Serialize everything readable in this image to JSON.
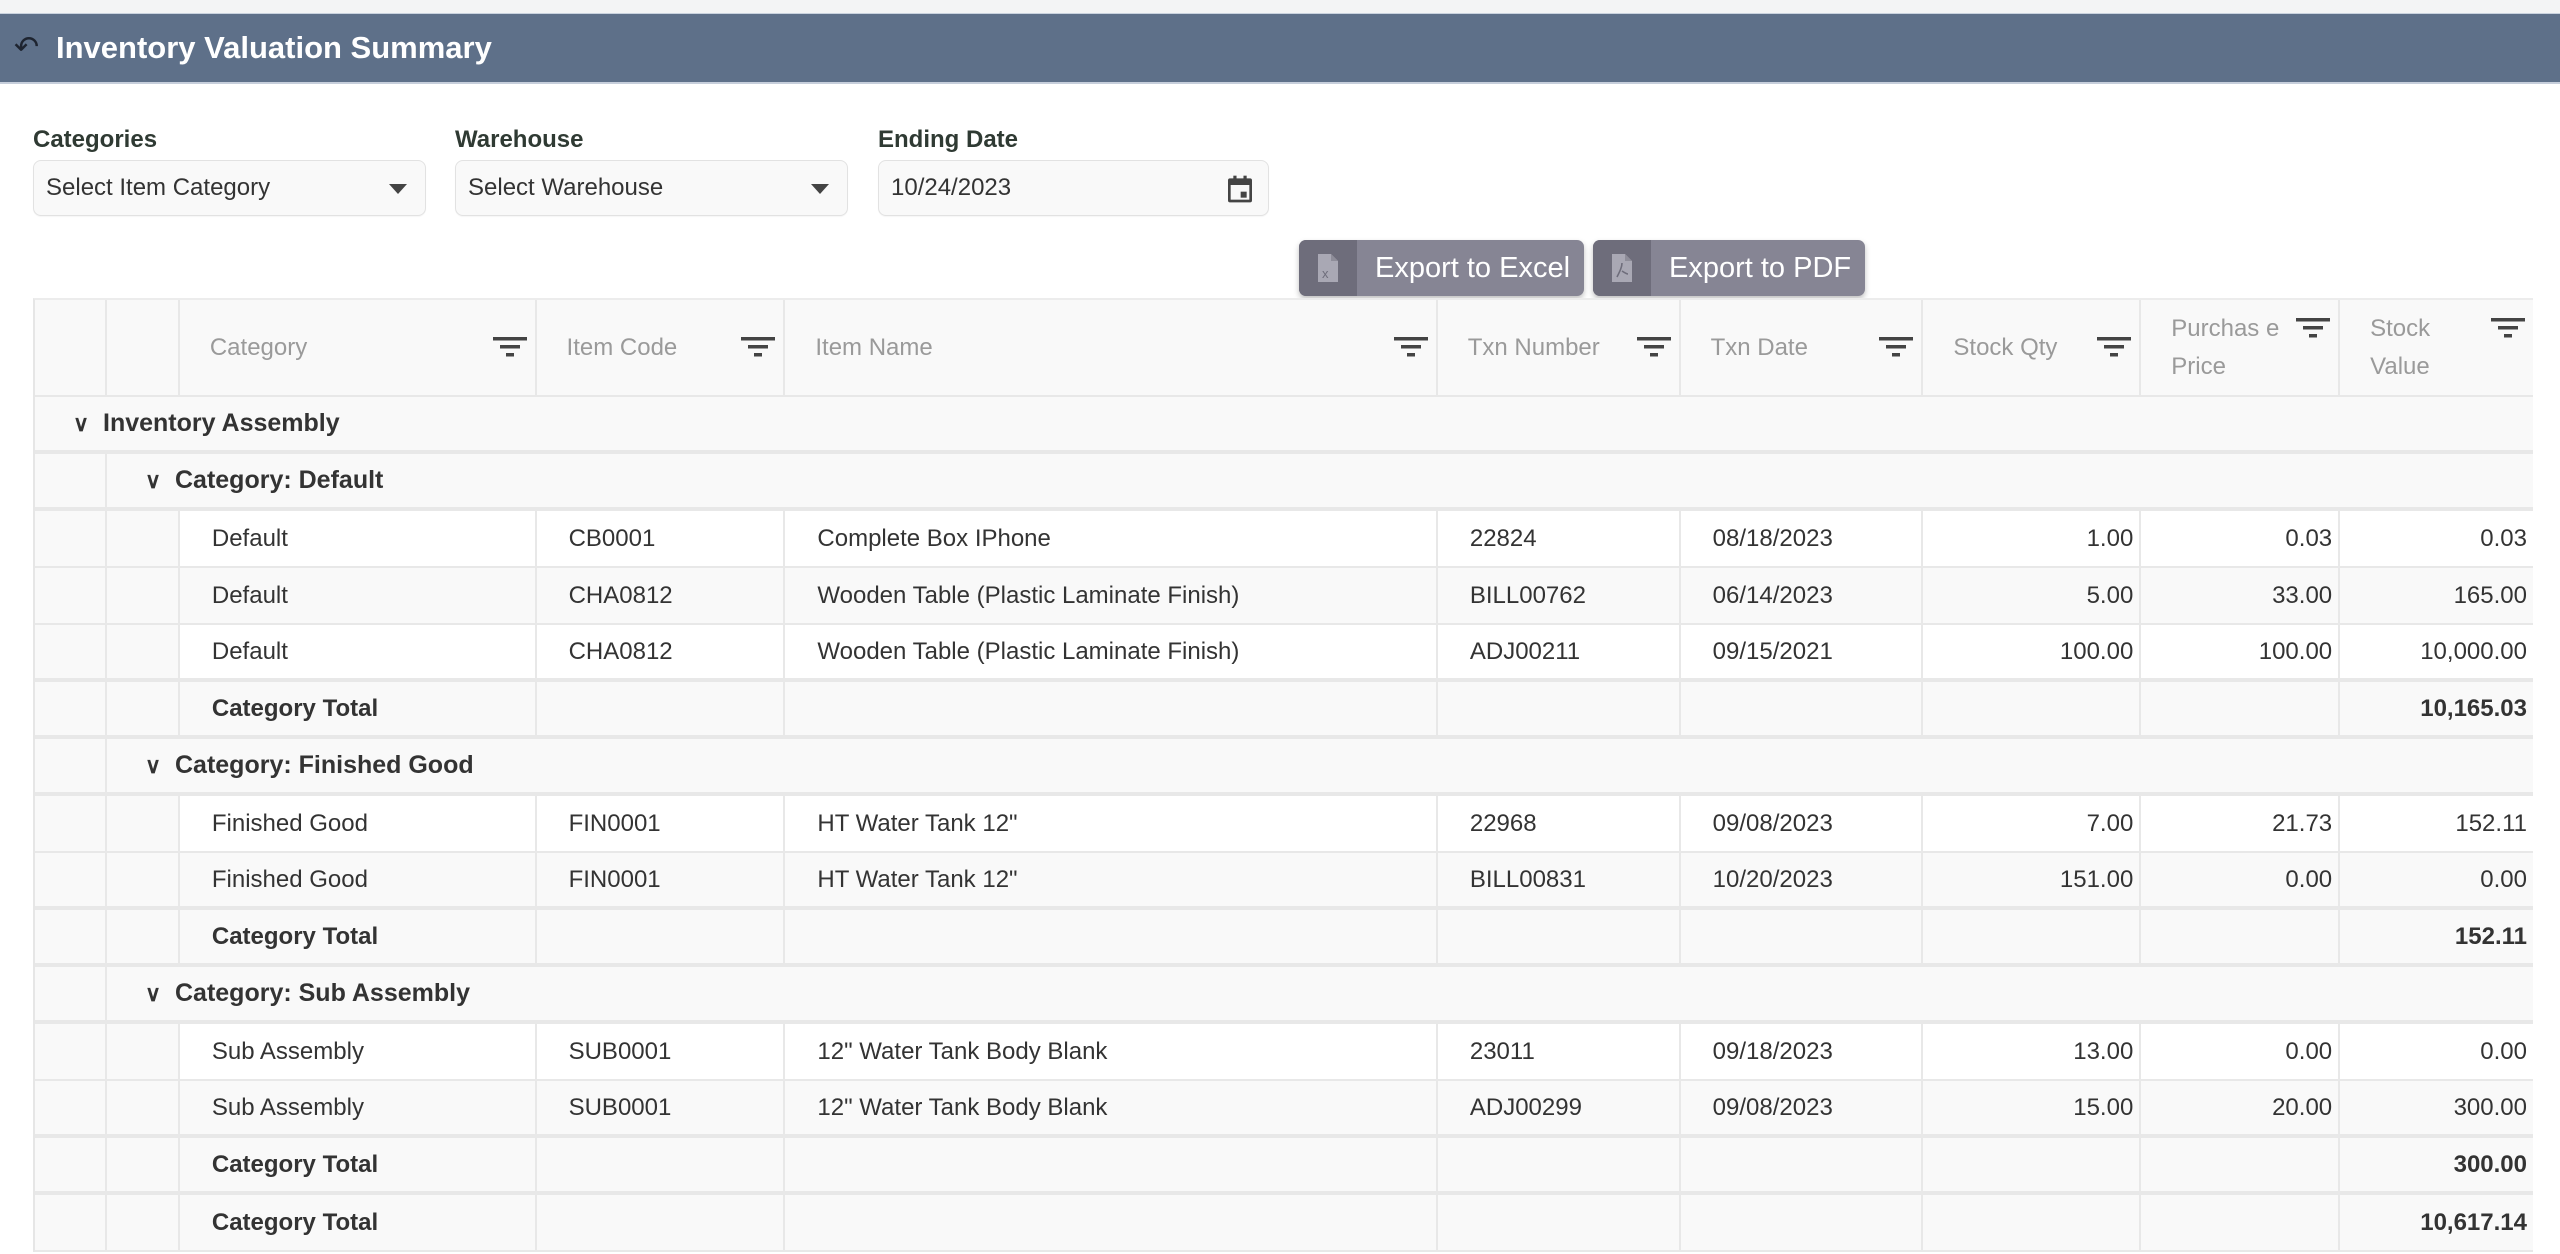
{
  "header": {
    "back_icon": "undo-arrow-icon",
    "title": "Inventory Valuation Summary"
  },
  "filters": {
    "categories": {
      "label": "Categories",
      "value": "Select Item Category"
    },
    "warehouse": {
      "label": "Warehouse",
      "value": "Select Warehouse"
    },
    "ending_date": {
      "label": "Ending Date",
      "value": "10/24/2023"
    },
    "export_excel": {
      "label": "Export to Excel",
      "icon": "excel-file-icon"
    },
    "export_pdf": {
      "label": "Export to PDF",
      "icon": "pdf-file-icon"
    }
  },
  "table": {
    "columns": [
      "Category",
      "Item Code",
      "Item Name",
      "Txn Number",
      "Txn Date",
      "Stock Qty",
      "Purchase Price",
      "Stock Value"
    ],
    "column_display": [
      "Category",
      "Item Code",
      "Item Name",
      "Txn Number",
      "Txn Date",
      "Stock Qty",
      "Purchas e Price",
      "Stock Value"
    ],
    "top_group": "Inventory Assembly",
    "groups": [
      {
        "title": "Category: Default",
        "rows": [
          [
            "Default",
            "CB0001",
            "Complete Box IPhone",
            "22824",
            "08/18/2023",
            "1.00",
            "0.03",
            "0.03"
          ],
          [
            "Default",
            "CHA0812",
            "Wooden Table (Plastic Laminate Finish)",
            "BILL00762",
            "06/14/2023",
            "5.00",
            "33.00",
            "165.00"
          ],
          [
            "Default",
            "CHA0812",
            "Wooden Table (Plastic Laminate Finish)",
            "ADJ00211",
            "09/15/2021",
            "100.00",
            "100.00",
            "10,000.00"
          ]
        ],
        "total_label": "Category Total",
        "total_value": "10,165.03"
      },
      {
        "title": "Category: Finished Good",
        "rows": [
          [
            "Finished Good",
            "FIN0001",
            "HT Water Tank 12\"",
            "22968",
            "09/08/2023",
            "7.00",
            "21.73",
            "152.11"
          ],
          [
            "Finished Good",
            "FIN0001",
            "HT Water Tank 12\"",
            "BILL00831",
            "10/20/2023",
            "151.00",
            "0.00",
            "0.00"
          ]
        ],
        "total_label": "Category Total",
        "total_value": "152.11"
      },
      {
        "title": "Category: Sub Assembly",
        "rows": [
          [
            "Sub Assembly",
            "SUB0001",
            "12\" Water Tank Body Blank",
            "23011",
            "09/18/2023",
            "13.00",
            "0.00",
            "0.00"
          ],
          [
            "Sub Assembly",
            "SUB0001",
            "12\" Water Tank Body Blank",
            "ADJ00299",
            "09/08/2023",
            "15.00",
            "20.00",
            "300.00"
          ]
        ],
        "total_label": "Category Total",
        "total_value": "300.00"
      }
    ],
    "grand_total_label": "Category Total",
    "grand_total_value": "10,617.14"
  },
  "colors": {
    "header_bar": "#5e7089",
    "export_button": "#868594",
    "export_button_icon_bg": "#6e6d7b"
  }
}
